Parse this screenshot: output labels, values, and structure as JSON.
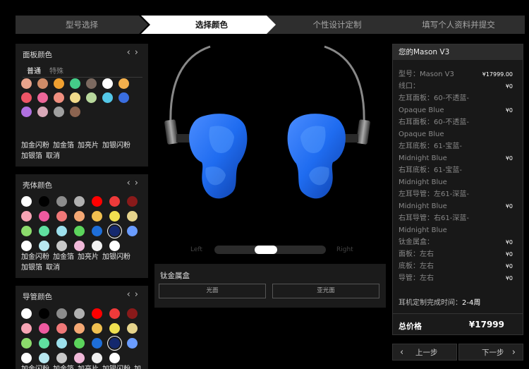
{
  "steps": [
    "型号选择",
    "选择颜色",
    "个性设计定制",
    "填写个人资料并提交"
  ],
  "panel_face": {
    "title": "面板颜色",
    "tabs": [
      "普通",
      "特殊"
    ],
    "swatches": [
      "#e8a48c",
      "#d08c68",
      "#f0a030",
      "#44cc88",
      "#7c6a60",
      "#ffffff",
      "#f4b04c",
      "#ee5566",
      "#ee6699",
      "#f08f7f",
      "#f2da8a",
      "#b8d89c",
      "#54c8e8",
      "#3a6ee0",
      "#b070e0",
      "#d8a8b8",
      "#a0a0a0",
      "#8c6450"
    ],
    "options": [
      "加金闪粉",
      "加金箔",
      "加亮片",
      "加银闪粉",
      "加银箔",
      "取消"
    ]
  },
  "panel_shell": {
    "title": "壳体颜色",
    "swatches": [
      "#ffffff",
      "#000000",
      "#8c8c8c",
      "#b0b0b0",
      "#ff0000",
      "#ee3a3a",
      "#8a1a1a",
      "#f6a4b4",
      "#ee5aa0",
      "#f07878",
      "#f4a874",
      "#f0c050",
      "#f0e050",
      "#e6d48c",
      "#8cdc6c",
      "#60e0a0",
      "#9ce0ec",
      "#5cd45c",
      "#1e6ed8",
      "#14286e",
      "#6a9cff",
      "#ffffff",
      "#b8e8f0",
      "#c8c8c8",
      "#f0b8d8",
      "#f0f0f0",
      "#ffffff"
    ],
    "options": [
      "加金闪粉",
      "加金箔",
      "加亮片",
      "加银闪粉",
      "加银箔",
      "取消"
    ]
  },
  "panel_tube": {
    "title": "导管颜色",
    "swatches": [
      "#ffffff",
      "#000000",
      "#8c8c8c",
      "#b0b0b0",
      "#ff0000",
      "#ee3a3a",
      "#8a1a1a",
      "#f6a4b4",
      "#ee5aa0",
      "#f07878",
      "#f4a874",
      "#f0c050",
      "#f0e050",
      "#e6d48c",
      "#8cdc6c",
      "#60e0a0",
      "#9ce0ec",
      "#5cd45c",
      "#1e6ed8",
      "#14286e",
      "#6a9cff",
      "#ffffff",
      "#b8e8f0",
      "#c8c8c8",
      "#f0b8d8",
      "#f0f0f0",
      "#ffffff"
    ],
    "options": [
      "加金闪粉",
      "加金箔",
      "加亮片",
      "加银闪粉",
      "加"
    ]
  },
  "slider": {
    "left": "Left",
    "right": "Right",
    "position": 0.45
  },
  "case_panel": {
    "title": "钛金属盒",
    "buttons": [
      "光面",
      "亚光面"
    ]
  },
  "summary": {
    "header": "您的Mason V3",
    "lines": [
      {
        "label": "型号：Mason V3",
        "value": "¥17999.00"
      },
      {
        "label": "线口：",
        "value": "¥0"
      },
      {
        "label": "左耳面板：60-不透蓝-",
        "value": ""
      },
      {
        "label": "Opaque Blue",
        "value": "¥0"
      },
      {
        "label": "右耳面板：60-不透蓝-",
        "value": ""
      },
      {
        "label": "Opaque Blue",
        "value": ""
      },
      {
        "label": "左耳底板：61-宝蓝-",
        "value": ""
      },
      {
        "label": "Midnight Blue",
        "value": "¥0"
      },
      {
        "label": "右耳底板：61-宝蓝-",
        "value": ""
      },
      {
        "label": "Midnight Blue",
        "value": ""
      },
      {
        "label": "左耳导管：左61-深蓝-",
        "value": ""
      },
      {
        "label": "Midnight Blue",
        "value": "¥0"
      },
      {
        "label": "右耳导管：右61-深蓝-",
        "value": ""
      },
      {
        "label": "Midnight Blue",
        "value": ""
      },
      {
        "label": "钛金属盒：",
        "value": "¥0"
      },
      {
        "label": "面板：左右",
        "value": "¥0"
      },
      {
        "label": "底板：左右",
        "value": "¥0"
      },
      {
        "label": "导管：左右",
        "value": "¥0"
      }
    ],
    "finish_label": "耳机定制完成时间：",
    "finish_value": "2-4周",
    "total_label": "总价格",
    "total_value": "¥17999"
  },
  "nav": {
    "prev": "上一步",
    "next": "下一步"
  },
  "icons": {
    "prev": "chevron-left-icon",
    "next": "chevron-right-icon"
  },
  "colors": {
    "earphone_blue": "#1f6cf0",
    "background": "#000000",
    "panel": "#1b1b1b"
  }
}
